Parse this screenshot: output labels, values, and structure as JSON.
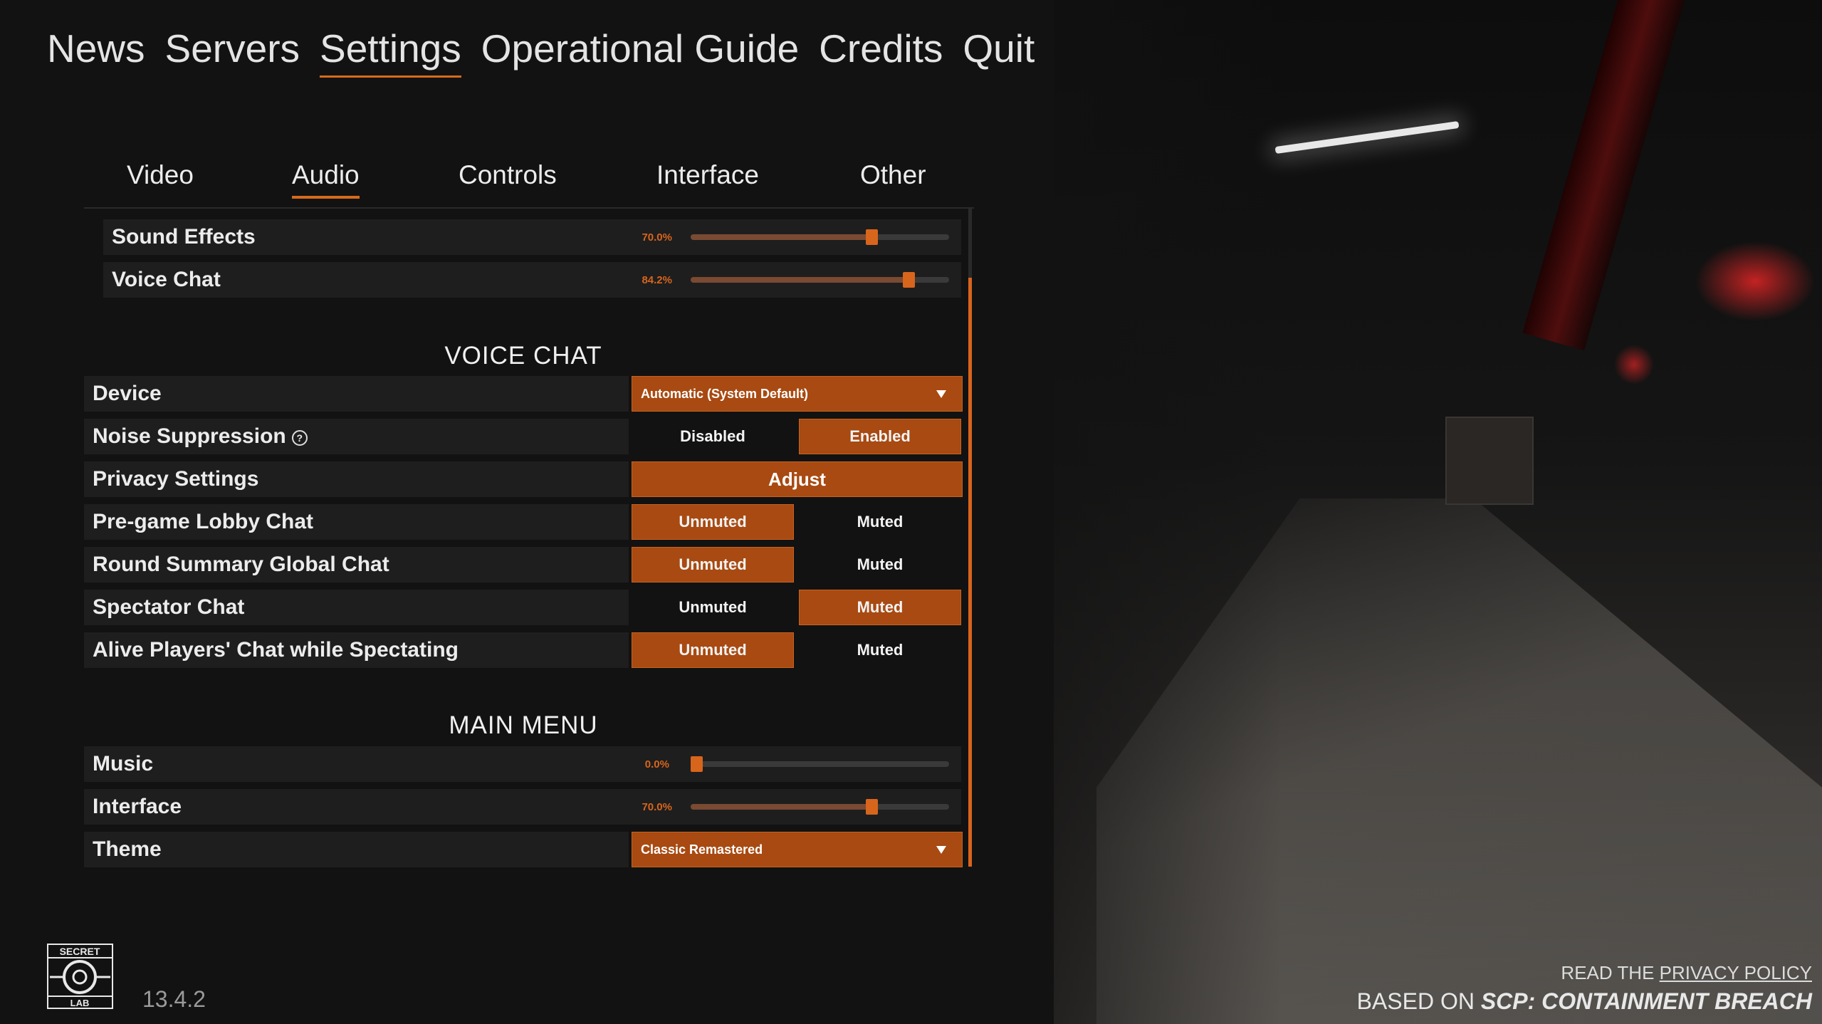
{
  "top_nav": {
    "items": [
      "News",
      "Servers",
      "Settings",
      "Operational Guide",
      "Credits",
      "Quit"
    ],
    "active": "Settings"
  },
  "sub_tabs": {
    "items": [
      "Video",
      "Audio",
      "Controls",
      "Interface",
      "Other"
    ],
    "active": "Audio"
  },
  "audio": {
    "sound_effects": {
      "label": "Sound Effects",
      "value_text": "70.0%",
      "value": 0.7
    },
    "voice_chat": {
      "label": "Voice Chat",
      "value_text": "84.2%",
      "value": 0.842
    }
  },
  "voice_chat_section": {
    "title": "VOICE CHAT",
    "device": {
      "label": "Device",
      "selected": "Automatic (System Default)"
    },
    "noise_suppression": {
      "label": "Noise Suppression",
      "help_glyph": "?",
      "options": [
        "Disabled",
        "Enabled"
      ],
      "selected": "Enabled"
    },
    "privacy_settings": {
      "label": "Privacy Settings",
      "button": "Adjust"
    },
    "pregame_lobby_chat": {
      "label": "Pre-game Lobby Chat",
      "options": [
        "Unmuted",
        "Muted"
      ],
      "selected": "Unmuted"
    },
    "round_summary_global_chat": {
      "label": "Round Summary Global Chat",
      "options": [
        "Unmuted",
        "Muted"
      ],
      "selected": "Unmuted"
    },
    "spectator_chat": {
      "label": "Spectator Chat",
      "options": [
        "Unmuted",
        "Muted"
      ],
      "selected": "Muted"
    },
    "alive_players_chat": {
      "label": "Alive Players' Chat while Spectating",
      "options": [
        "Unmuted",
        "Muted"
      ],
      "selected": "Unmuted"
    }
  },
  "main_menu_section": {
    "title": "MAIN MENU",
    "music": {
      "label": "Music",
      "value_text": "0.0%",
      "value": 0.0
    },
    "interface": {
      "label": "Interface",
      "value_text": "70.0%",
      "value": 0.7
    },
    "theme": {
      "label": "Theme",
      "selected": "Classic Remastered"
    }
  },
  "footer": {
    "logo_text_top": "SECRET",
    "logo_text_bottom": "LAB",
    "version": "13.4.2",
    "privacy_prefix": "READ THE",
    "privacy_link": "PRIVACY POLICY",
    "based_prefix": "BASED ON",
    "based_game": "SCP: CONTAINMENT BREACH"
  },
  "colors": {
    "accent": "#d8651c",
    "button_on": "#a84a12",
    "row_bg": "#1e1e1e",
    "background": "#121212"
  }
}
